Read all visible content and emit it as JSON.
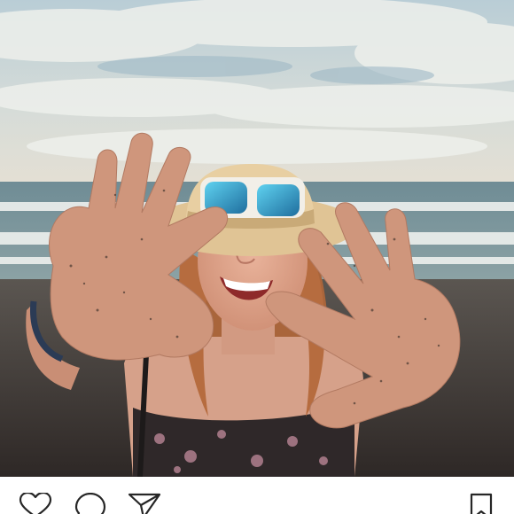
{
  "post": {
    "photo": {
      "alt": ""
    },
    "actions": {
      "like": {
        "icon": "heart-icon"
      },
      "comment": {
        "icon": "comment-bubble-icon"
      },
      "share": {
        "icon": "paper-plane-icon"
      },
      "save": {
        "icon": "bookmark-icon"
      }
    }
  },
  "colors": {
    "icon_stroke": "#262626",
    "background": "#ffffff",
    "sky": "#c9d9e0",
    "sea": "#6e8890",
    "sand": "#3a3431",
    "skin": "#d9a089",
    "hair": "#b56a3f",
    "hat": "#e3c99b"
  }
}
